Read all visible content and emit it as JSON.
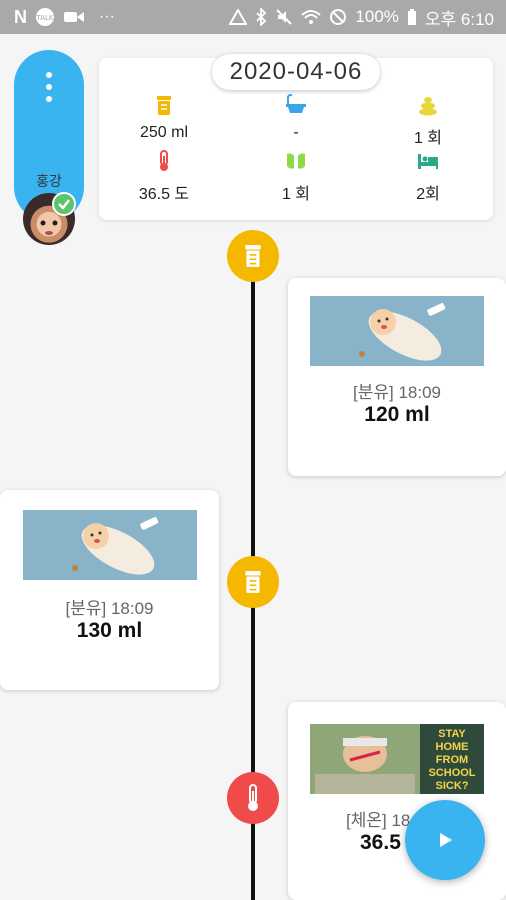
{
  "status_bar": {
    "left_n": "N",
    "left_dots": "···",
    "battery": "100%",
    "time": "오후 6:10"
  },
  "profile": {
    "name": "홍강"
  },
  "summary": {
    "date": "2020-04-06",
    "feed": "250 ml",
    "bath": "-",
    "poop": "1 회",
    "temp": "36.5 도",
    "diaper": "1 회",
    "sleep": "2회"
  },
  "timeline": [
    {
      "label": "[분유] 18:09",
      "value": "120 ml"
    },
    {
      "label": "[분유] 18:09",
      "value": "130 ml"
    },
    {
      "label": "[체온] 18",
      "value": "36.5",
      "poster": [
        "STAY",
        "HOME",
        "FROM",
        "SCHOOL",
        "SICK?"
      ]
    }
  ],
  "colors": {
    "accent": "#39b4f0",
    "feed": "#f5b800",
    "temp": "#ef4b4b",
    "diaper": "#8cd94a",
    "sleep": "#2aa98a",
    "bath": "#3aa5e8",
    "poop": "#e8d63a"
  }
}
